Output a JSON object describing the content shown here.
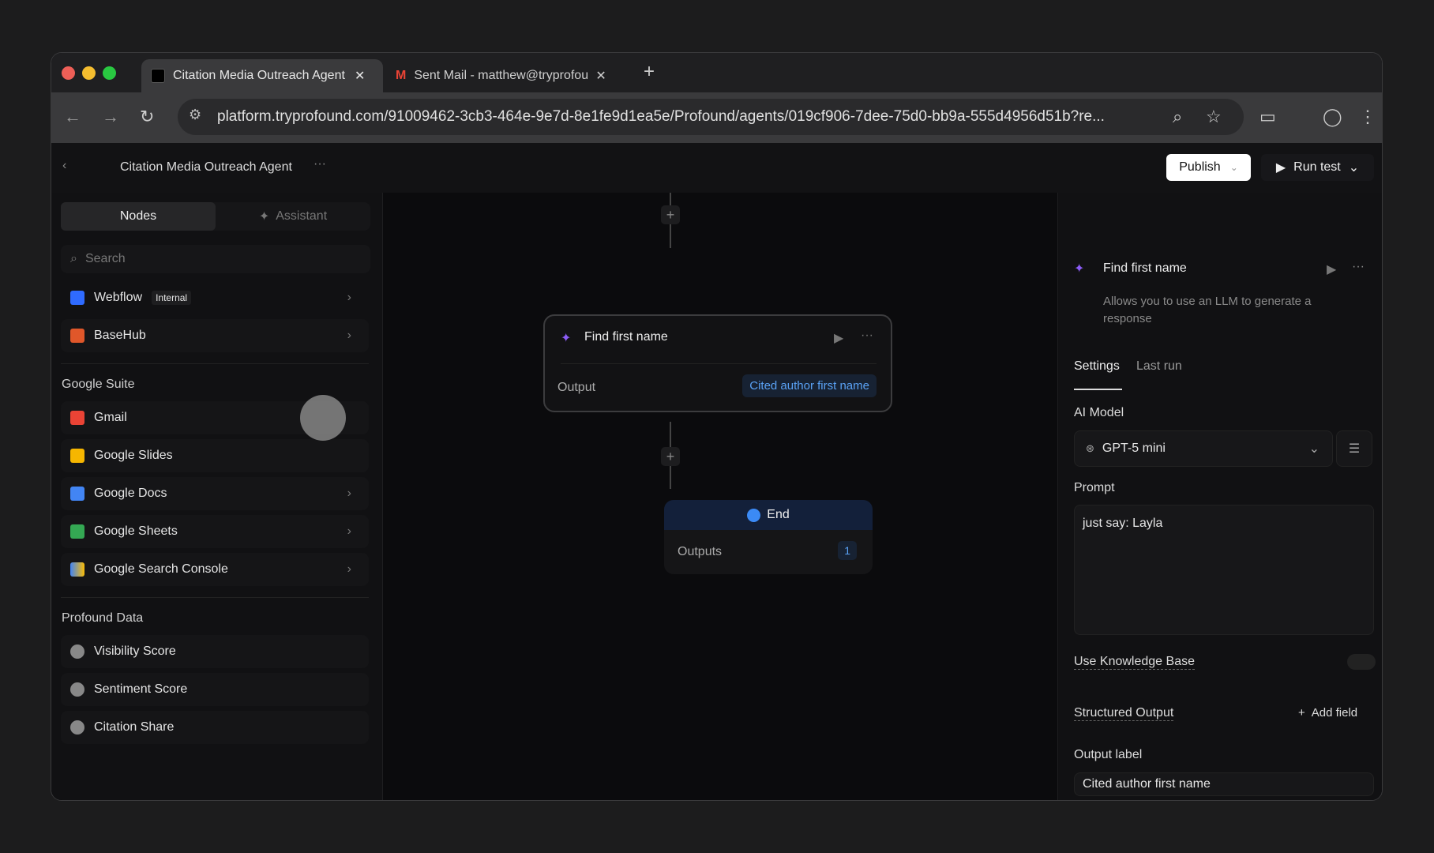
{
  "browser": {
    "tabs": [
      {
        "title": "Citation Media Outreach Agent"
      },
      {
        "title": "Sent Mail - matthew@tryprofound.com"
      }
    ],
    "new_tab": "+",
    "url": "platform.tryprofound.com/91009462-3cb3-464e-9e7d-8e1fe9d1ea5e/Profound/agents/019cf906-7dee-75d0-bb9a-555d4956d51b?re..."
  },
  "header": {
    "title": "Citation Media Outreach Agent",
    "publish": "Publish",
    "run_test": "Run test"
  },
  "sidebar": {
    "tabs": [
      "Nodes",
      "Assistant"
    ],
    "search_placeholder": "Search",
    "items_top": [
      {
        "label": "Webflow",
        "badge": "Internal",
        "color": "#2f6bff"
      },
      {
        "label": "BaseHub",
        "color": "#e0572a"
      }
    ],
    "sections": [
      {
        "title": "Google Suite",
        "items": [
          {
            "label": "Gmail",
            "color": "#ea4335"
          },
          {
            "label": "Google Slides",
            "color": "#f6b600"
          },
          {
            "label": "Google Docs",
            "color": "#4285f4"
          },
          {
            "label": "Google Sheets",
            "color": "#34a853"
          },
          {
            "label": "Google Search Console",
            "color": "#4285f4"
          }
        ]
      },
      {
        "title": "Profound Data",
        "items": [
          {
            "label": "Visibility Score",
            "color": "#888888"
          },
          {
            "label": "Sentiment Score",
            "color": "#888888"
          },
          {
            "label": "Citation Share",
            "color": "#888888"
          }
        ]
      }
    ]
  },
  "canvas": {
    "node": {
      "title": "Find first name",
      "output_label": "Output",
      "output_value": "Cited author first name"
    },
    "end": {
      "title": "End",
      "outputs_label": "Outputs",
      "outputs_count": "1"
    }
  },
  "panel": {
    "title": "Find first name",
    "description": "Allows you to use an LLM to generate a response",
    "tabs": [
      "Settings",
      "Last run"
    ],
    "ai_model_label": "AI Model",
    "ai_model": "GPT-5 mini",
    "prompt_label": "Prompt",
    "prompt": "just say: Layla",
    "knowledge_base_label": "Use Knowledge Base",
    "knowledge_base_on": false,
    "structured_output_label": "Structured Output",
    "add_field": "Add field",
    "output_label_label": "Output label",
    "output_label": "Cited author first name"
  }
}
